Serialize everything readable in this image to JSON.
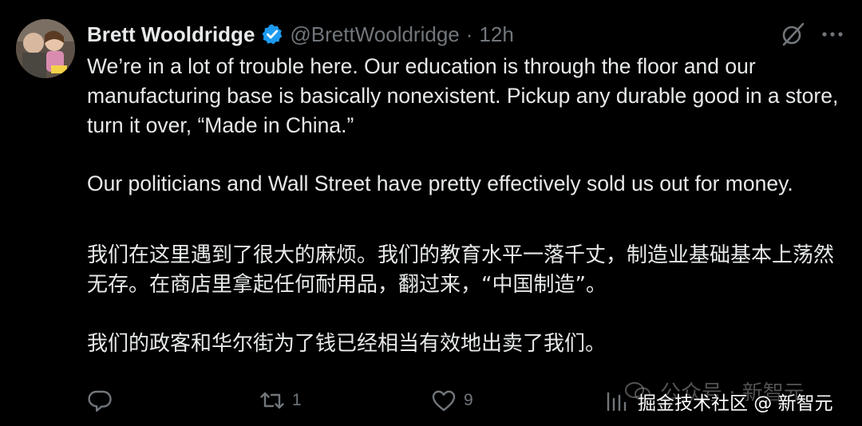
{
  "tweet": {
    "author": {
      "name": "Brett Wooldridge",
      "handle": "@BrettWooldridge",
      "verified": true,
      "verified_color": "#1d9bf0"
    },
    "separator": "·",
    "time": "12h",
    "text_en": [
      "We’re in a lot of trouble here. Our education is through the floor and our manufacturing base is basically nonexistent. Pickup any durable good in a store, turn it over, “Made in China.”",
      "Our politicians and Wall Street have pretty effectively sold us out for money."
    ],
    "text_zh": [
      "我们在这里遇到了很大的麻烦。我们的教育水平一落千丈，制造业基础基本上荡然无存。在商店里拿起任何耐用品，翻过来，“中国制造”。",
      "我们的政客和华尔街为了钱已经相当有效地出卖了我们。"
    ],
    "actions": {
      "reply": {
        "icon": "reply-icon",
        "count": ""
      },
      "repost": {
        "icon": "repost-icon",
        "count": "1"
      },
      "like": {
        "icon": "heart-icon",
        "count": "9"
      },
      "views": {
        "icon": "views-icon",
        "count": ""
      }
    },
    "header_icons": [
      "grok-icon",
      "more-icon"
    ]
  },
  "watermark": {
    "line1": "公众号 · 新智元",
    "line2": "掘金技术社区 @ 新智元"
  },
  "colors": {
    "background": "#000000",
    "text": "#e7e9ea",
    "muted": "#71767b"
  }
}
